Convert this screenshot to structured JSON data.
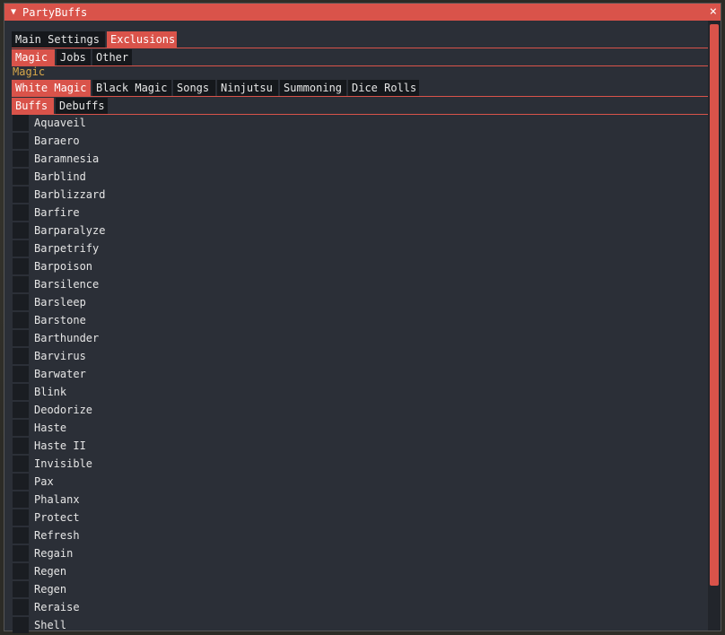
{
  "window": {
    "title": "PartyBuffs",
    "close_label": "×",
    "collapse_label": "▼"
  },
  "main_tabs": [
    {
      "label": "Main Settings",
      "active": false
    },
    {
      "label": "Exclusions",
      "active": true
    }
  ],
  "sub_tabs": [
    {
      "label": "Magic",
      "active": true
    },
    {
      "label": "Jobs",
      "active": false
    },
    {
      "label": "Other",
      "active": false
    }
  ],
  "section_label": "Magic",
  "magic_tabs": [
    {
      "label": "White Magic",
      "active": true
    },
    {
      "label": "Black Magic",
      "active": false
    },
    {
      "label": "Songs",
      "active": false
    },
    {
      "label": "Ninjutsu",
      "active": false
    },
    {
      "label": "Summoning",
      "active": false
    },
    {
      "label": "Dice Rolls",
      "active": false
    }
  ],
  "type_tabs": [
    {
      "label": "Buffs",
      "active": true
    },
    {
      "label": "Debuffs",
      "active": false
    }
  ],
  "spells": [
    "Aquaveil",
    "Baraero",
    "Baramnesia",
    "Barblind",
    "Barblizzard",
    "Barfire",
    "Barparalyze",
    "Barpetrify",
    "Barpoison",
    "Barsilence",
    "Barsleep",
    "Barstone",
    "Barthunder",
    "Barvirus",
    "Barwater",
    "Blink",
    "Deodorize",
    "Haste",
    "Haste II",
    "Invisible",
    "Pax",
    "Phalanx",
    "Protect",
    "Refresh",
    "Regain",
    "Regen",
    "Regen",
    "Reraise",
    "Shell"
  ]
}
